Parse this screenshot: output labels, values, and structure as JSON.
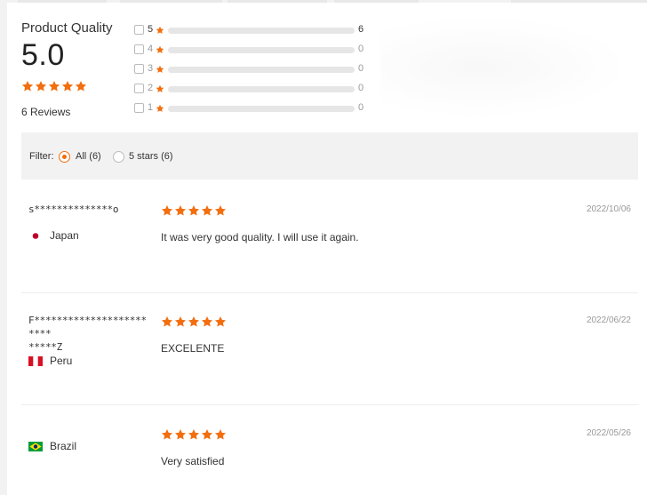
{
  "summary": {
    "title": "Product Quality",
    "score": "5.0",
    "stars": 5,
    "reviews_count": "6 Reviews"
  },
  "distribution": [
    {
      "stars": "5",
      "count": "6",
      "fraction": 1.0
    },
    {
      "stars": "4",
      "count": "0",
      "fraction": 0
    },
    {
      "stars": "3",
      "count": "0",
      "fraction": 0
    },
    {
      "stars": "2",
      "count": "0",
      "fraction": 0
    },
    {
      "stars": "1",
      "count": "0",
      "fraction": 0
    }
  ],
  "filter": {
    "label": "Filter:",
    "options": [
      {
        "label": "All (6)",
        "selected": true
      },
      {
        "label": "5 stars (6)",
        "selected": false
      }
    ]
  },
  "reviews": [
    {
      "reviewer": "s**************o",
      "country": "Japan",
      "flag": "japan-flag-icon",
      "stars": 5,
      "text": "It was very good quality. I will use it again.",
      "date": "2022/10/06"
    },
    {
      "reviewer": "F************************\n*****Z",
      "country": "Peru",
      "flag": "peru-flag-icon",
      "stars": 5,
      "text": "EXCELENTE",
      "date": "2022/06/22"
    },
    {
      "reviewer": "",
      "country": "Brazil",
      "flag": "brazil-flag-icon",
      "stars": 5,
      "text": "Very satisfied",
      "date": "2022/05/26"
    }
  ],
  "colors": {
    "accent": "#f26e0f",
    "track": "#e6e6e6",
    "filter_bg": "#f2f2f2"
  }
}
